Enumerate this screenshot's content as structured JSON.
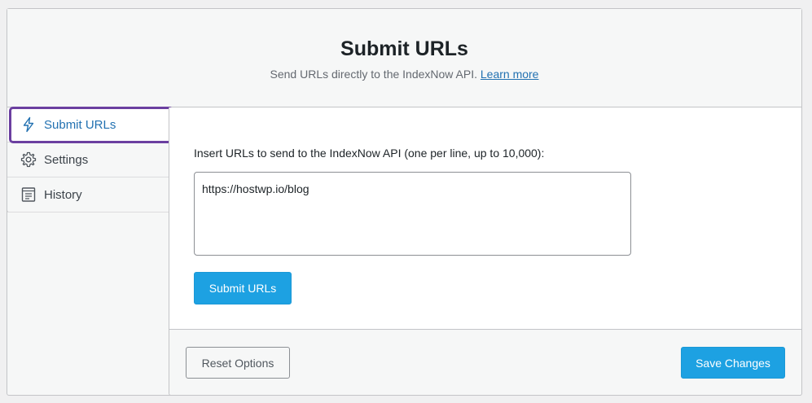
{
  "header": {
    "title": "Submit URLs",
    "subtitle": "Send URLs directly to the IndexNow API.",
    "learn_more": "Learn more"
  },
  "sidebar": {
    "items": [
      {
        "label": "Submit URLs",
        "icon": "lightning-bolt-icon",
        "active": true
      },
      {
        "label": "Settings",
        "icon": "gear-icon",
        "active": false
      },
      {
        "label": "History",
        "icon": "document-list-icon",
        "active": false
      }
    ]
  },
  "main": {
    "input_label": "Insert URLs to send to the IndexNow API (one per line, up to 10,000):",
    "urls_value": "https://hostwp.io/blog",
    "submit_label": "Submit URLs"
  },
  "footer": {
    "reset_label": "Reset Options",
    "save_label": "Save Changes"
  },
  "colors": {
    "accent": "#1da1e2",
    "active_text": "#2271b1",
    "highlight_outline": "#6b3fa0"
  }
}
